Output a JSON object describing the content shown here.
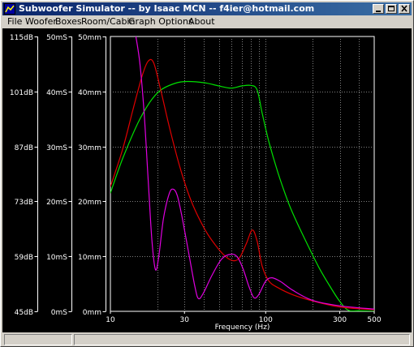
{
  "window": {
    "title": "Subwoofer Simulator -- by Isaac MCN -- f4ier@hotmail.com"
  },
  "menu": {
    "items": [
      "File",
      "Woofer",
      "Boxes",
      "Room/Cabin",
      "Graph Options",
      "About"
    ]
  },
  "chart_data": {
    "type": "line",
    "xlabel": "Frequency (Hz)",
    "x_scale": "log",
    "xlim": [
      10,
      500
    ],
    "x_ticks": [
      10,
      30,
      100,
      300,
      500
    ],
    "axes": [
      {
        "name": "level",
        "ticks": [
          "115dB",
          "101dB",
          "87dB",
          "73dB",
          "59dB",
          "45dB"
        ]
      },
      {
        "name": "delay",
        "ticks": [
          "50mS",
          "40mS",
          "30mS",
          "20mS",
          "10mS",
          "0mS"
        ]
      },
      {
        "name": "excursion",
        "ticks": [
          "50mm",
          "40mm",
          "30mm",
          "20mm",
          "10mm",
          "0mm"
        ]
      }
    ],
    "ylim": [
      0,
      50
    ],
    "grid": true,
    "series": [
      {
        "color": "#00e000",
        "axis": "level",
        "points": [
          [
            10,
            21.5
          ],
          [
            12,
            27.8
          ],
          [
            15,
            34.2
          ],
          [
            18,
            38.1
          ],
          [
            21,
            40.2
          ],
          [
            25,
            41.3
          ],
          [
            30,
            41.8
          ],
          [
            40,
            41.6
          ],
          [
            50,
            41.0
          ],
          [
            60,
            40.6
          ],
          [
            70,
            41.0
          ],
          [
            80,
            41.1
          ],
          [
            88,
            40.3
          ],
          [
            95,
            36.0
          ],
          [
            105,
            30.8
          ],
          [
            120,
            25.2
          ],
          [
            140,
            19.8
          ],
          [
            160,
            16.0
          ],
          [
            190,
            11.6
          ],
          [
            220,
            8.0
          ],
          [
            260,
            4.5
          ],
          [
            300,
            1.8
          ],
          [
            340,
            0.2
          ],
          [
            400,
            0.1
          ],
          [
            500,
            0.0
          ]
        ]
      },
      {
        "color": "#e00000",
        "axis": "delay",
        "points": [
          [
            10,
            22.7
          ],
          [
            12,
            29.5
          ],
          [
            14,
            36.8
          ],
          [
            16,
            42.8
          ],
          [
            17.5,
            45.5
          ],
          [
            19,
            45.2
          ],
          [
            21,
            40.5
          ],
          [
            24,
            33.5
          ],
          [
            28,
            26.3
          ],
          [
            33,
            20.2
          ],
          [
            40,
            15.2
          ],
          [
            47,
            12.2
          ],
          [
            55,
            10.0
          ],
          [
            62,
            9.2
          ],
          [
            68,
            9.8
          ],
          [
            75,
            12.3
          ],
          [
            82,
            14.8
          ],
          [
            88,
            12.8
          ],
          [
            95,
            8.2
          ],
          [
            105,
            5.5
          ],
          [
            120,
            4.3
          ],
          [
            150,
            3.0
          ],
          [
            200,
            1.9
          ],
          [
            300,
            0.8
          ],
          [
            500,
            0.3
          ]
        ]
      },
      {
        "color": "#e000e0",
        "axis": "excursion",
        "points": [
          [
            14.6,
            50.0
          ],
          [
            15.5,
            45.0
          ],
          [
            16.5,
            36.0
          ],
          [
            17.5,
            24.0
          ],
          [
            18.5,
            13.0
          ],
          [
            19.5,
            7.6
          ],
          [
            20.5,
            10.0
          ],
          [
            22,
            17.0
          ],
          [
            24,
            21.5
          ],
          [
            25.5,
            22.2
          ],
          [
            27,
            21.0
          ],
          [
            29,
            17.0
          ],
          [
            32,
            10.5
          ],
          [
            35,
            4.5
          ],
          [
            37,
            2.3
          ],
          [
            40,
            3.5
          ],
          [
            45,
            6.5
          ],
          [
            52,
            9.5
          ],
          [
            60,
            10.4
          ],
          [
            66,
            9.8
          ],
          [
            72,
            7.5
          ],
          [
            78,
            4.5
          ],
          [
            84,
            2.5
          ],
          [
            90,
            3.0
          ],
          [
            100,
            5.5
          ],
          [
            110,
            6.1
          ],
          [
            125,
            5.4
          ],
          [
            150,
            3.8
          ],
          [
            200,
            2.0
          ],
          [
            300,
            1.0
          ],
          [
            500,
            0.4
          ]
        ]
      }
    ]
  }
}
